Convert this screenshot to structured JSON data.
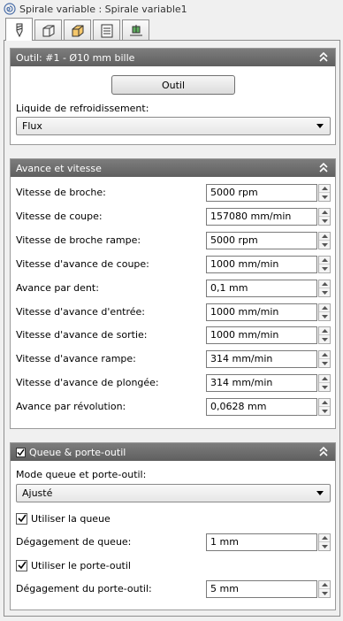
{
  "window": {
    "title": "Spirale variable : Spirale variable1",
    "title_icon": "spiral-icon"
  },
  "tabs": [
    {
      "icon": "tool-icon",
      "active": true
    },
    {
      "icon": "geometry-icon",
      "active": false
    },
    {
      "icon": "heights-icon",
      "active": false
    },
    {
      "icon": "passes-icon",
      "active": false
    },
    {
      "icon": "linking-icon",
      "active": false
    }
  ],
  "outil": {
    "header": "Outil: #1 - Ø10 mm bille",
    "button_label": "Outil",
    "coolant_label": "Liquide de refroidissement:",
    "coolant_value": "Flux"
  },
  "feeds": {
    "header": "Avance et vitesse",
    "fields": [
      {
        "label": "Vitesse de broche:",
        "value": "5000 rpm"
      },
      {
        "label": "Vitesse de coupe:",
        "value": "157080 mm/min"
      },
      {
        "label": "Vitesse de broche rampe:",
        "value": "5000 rpm"
      },
      {
        "label": "Vitesse d'avance de coupe:",
        "value": "1000 mm/min"
      },
      {
        "label": "Avance par dent:",
        "value": "0,1 mm"
      },
      {
        "label": "Vitesse d'avance d'entrée:",
        "value": "1000 mm/min"
      },
      {
        "label": "Vitesse d'avance de sortie:",
        "value": "1000 mm/min"
      },
      {
        "label": "Vitesse d'avance rampe:",
        "value": "314 mm/min"
      },
      {
        "label": "Vitesse d'avance de plongée:",
        "value": "314 mm/min"
      },
      {
        "label": "Avance par révolution:",
        "value": "0,0628 mm"
      }
    ]
  },
  "shank": {
    "header": "Queue & porte-outil",
    "header_checked": true,
    "mode_label": "Mode queue et porte-outil:",
    "mode_value": "Ajusté",
    "use_shank_label": "Utiliser la queue",
    "use_shank_checked": true,
    "shank_clearance_label": "Dégagement de queue:",
    "shank_clearance_value": "1 mm",
    "use_holder_label": "Utiliser le porte-outil",
    "use_holder_checked": true,
    "holder_clearance_label": "Dégagement du porte-outil:",
    "holder_clearance_value": "5 mm"
  }
}
